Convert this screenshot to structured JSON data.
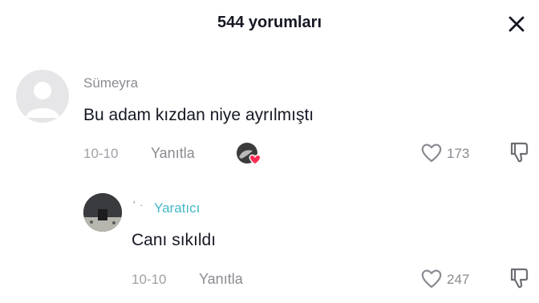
{
  "header": {
    "title": "544 yorumları"
  },
  "comments": [
    {
      "username": "Sümeyra",
      "text": "Bu adam kızdan niye ayrılmıştı",
      "date": "10-10",
      "reply_label": "Yanıtla",
      "likes": "173"
    },
    {
      "username_mark": "' ·",
      "creator_label": "Yaratıcı",
      "text": "Canı sıkıldı",
      "date": "10-10",
      "reply_label": "Yanıtla",
      "likes": "247"
    }
  ],
  "icons": {
    "close": "close-icon",
    "like": "heart-outline-icon",
    "dislike": "thumbs-down-icon",
    "creator_liked": "creator-liked-heart-icon"
  },
  "colors": {
    "accent_heart": "#fe2c55",
    "creator_tag": "#43b8c8"
  }
}
